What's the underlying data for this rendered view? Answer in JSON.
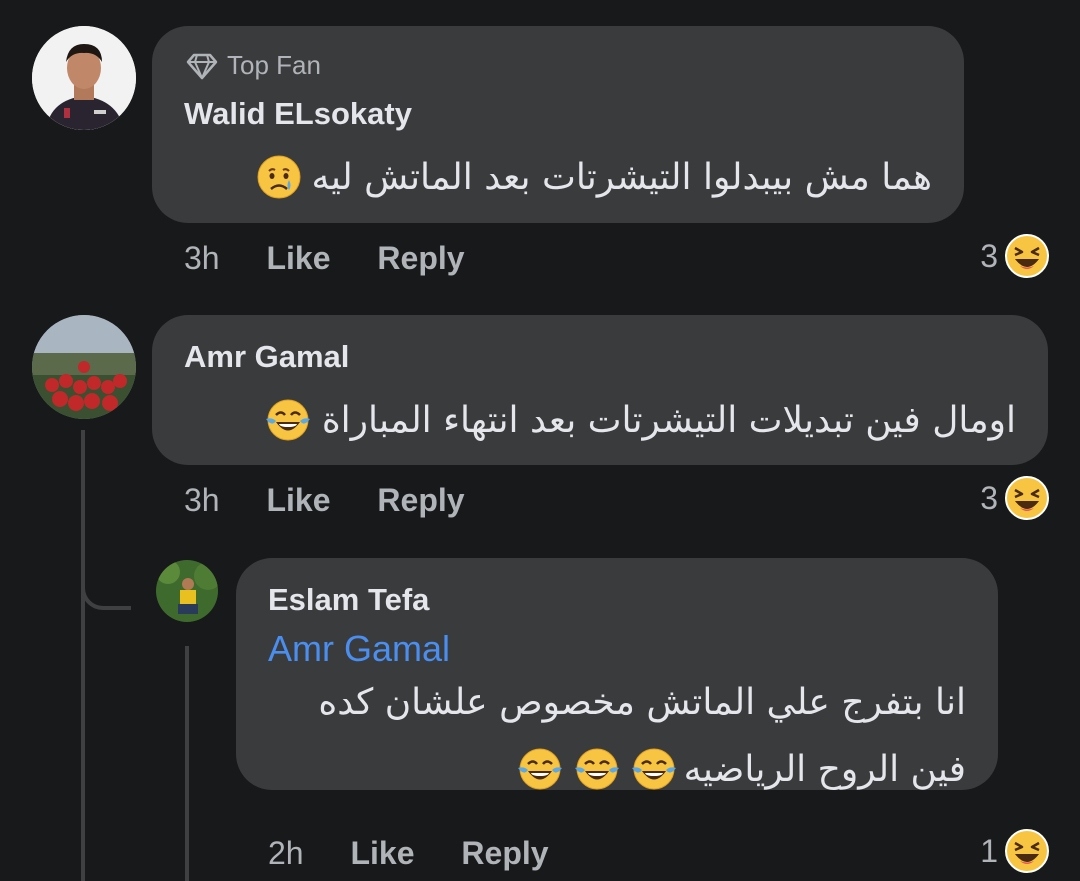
{
  "comments": [
    {
      "badge": "Top Fan",
      "author": "Walid ELsokaty",
      "text": "هما مش بيبدلوا التيشرتات بعد الماتش ليه",
      "time": "3h",
      "like": "Like",
      "reply": "Reply",
      "reaction_count": "3",
      "text_emoji": "crying-face",
      "reaction_emoji": "laughing-face"
    },
    {
      "author": "Amr Gamal",
      "text": "اومال فين تبديلات التيشرتات بعد انتهاء المباراة",
      "time": "3h",
      "like": "Like",
      "reply": "Reply",
      "reaction_count": "3",
      "text_emoji": "tears-of-joy-face",
      "reaction_emoji": "laughing-face"
    },
    {
      "author": "Eslam Tefa",
      "mention": "Amr Gamal",
      "text_line1": "انا بتفرج علي الماتش مخصوص علشان كده",
      "text_line2": "فين الروح الرياضيه",
      "time": "2h",
      "like": "Like",
      "reply": "Reply",
      "reaction_count": "1",
      "text_emoji": "tears-of-joy-face",
      "reaction_emoji": "laughing-face"
    }
  ],
  "colors": {
    "background": "#18191a",
    "bubble": "#3a3b3c",
    "mention": "#4a8ef0",
    "meta": "#b0b3b8"
  }
}
